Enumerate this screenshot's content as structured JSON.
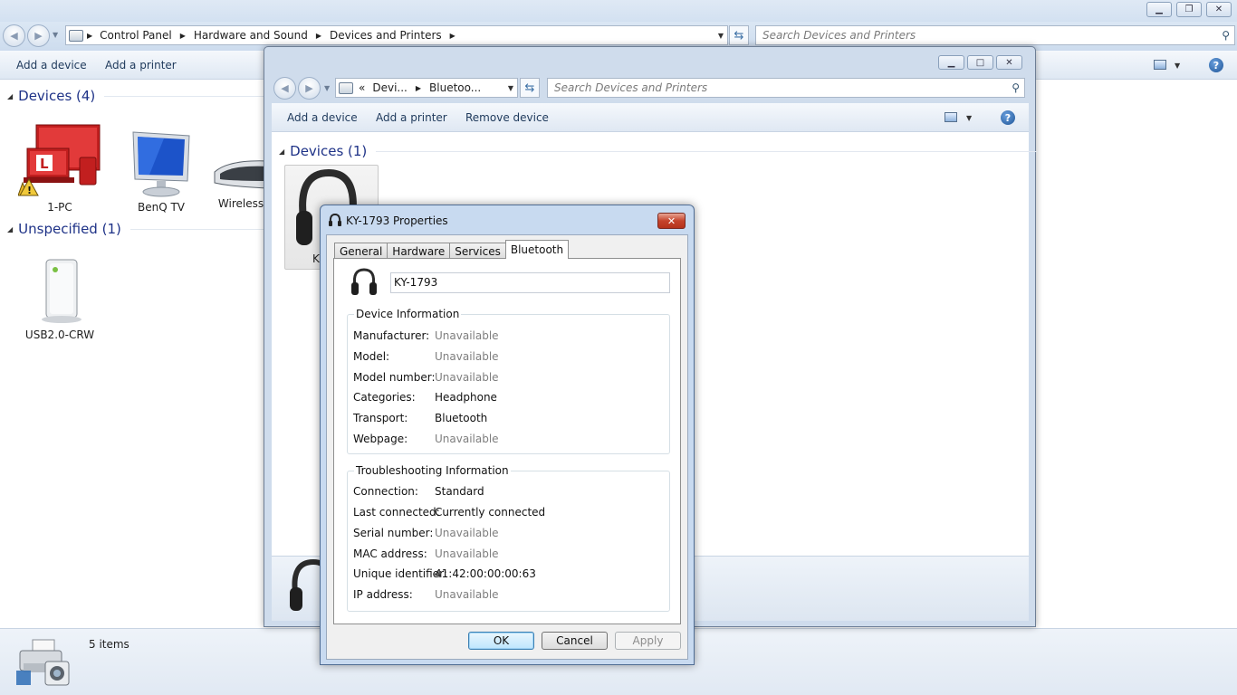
{
  "main_window": {
    "breadcrumbs": [
      "Control Panel",
      "Hardware and Sound",
      "Devices and Printers"
    ],
    "search_placeholder": "Search Devices and Printers",
    "commands": {
      "add_device": "Add a device",
      "add_printer": "Add a printer"
    },
    "groups": [
      {
        "title": "Devices (4)",
        "items": [
          "1-PC",
          "BenQ TV",
          "Wireless"
        ]
      },
      {
        "title": "Unspecified (1)",
        "items": [
          "USB2.0-CRW"
        ]
      }
    ],
    "status_text": "5 items"
  },
  "second_window": {
    "breadcrumb_prefix": "«",
    "breadcrumbs": [
      "Devi...",
      "Bluetoo..."
    ],
    "search_placeholder": "Search Devices and Printers",
    "commands": {
      "add_device": "Add a device",
      "add_printer": "Add a printer",
      "remove_device": "Remove device"
    },
    "group_title": "Devices (1)",
    "selected_partial_label": "KY"
  },
  "dialog": {
    "title": "KY-1793 Properties",
    "close_glyph": "✕",
    "tabs": [
      "General",
      "Hardware",
      "Services",
      "Bluetooth"
    ],
    "active_tab": "Bluetooth",
    "device_name": "KY-1793",
    "device_info": {
      "title": "Device Information",
      "rows": [
        {
          "label": "Manufacturer:",
          "value": "Unavailable"
        },
        {
          "label": "Model:",
          "value": "Unavailable"
        },
        {
          "label": "Model number:",
          "value": "Unavailable"
        },
        {
          "label": "Categories:",
          "value": "Headphone"
        },
        {
          "label": "Transport:",
          "value": "Bluetooth"
        },
        {
          "label": "Webpage:",
          "value": "Unavailable"
        }
      ]
    },
    "troubleshooting": {
      "title": "Troubleshooting Information",
      "rows": [
        {
          "label": "Connection:",
          "value": "Standard"
        },
        {
          "label": "Last connected:",
          "value": "Currently connected"
        },
        {
          "label": "Serial number:",
          "value": "Unavailable"
        },
        {
          "label": "MAC address:",
          "value": "Unavailable"
        },
        {
          "label": "Unique identifier:",
          "value": "41:42:00:00:00:63"
        },
        {
          "label": "IP address:",
          "value": "Unavailable"
        }
      ]
    },
    "buttons": {
      "ok": "OK",
      "cancel": "Cancel",
      "apply": "Apply"
    }
  },
  "colors": {
    "group_title": "#1e3287",
    "command_text": "#1e395b",
    "close_red": "#c5432c",
    "unavailable_gray": "#7e7e7e"
  }
}
